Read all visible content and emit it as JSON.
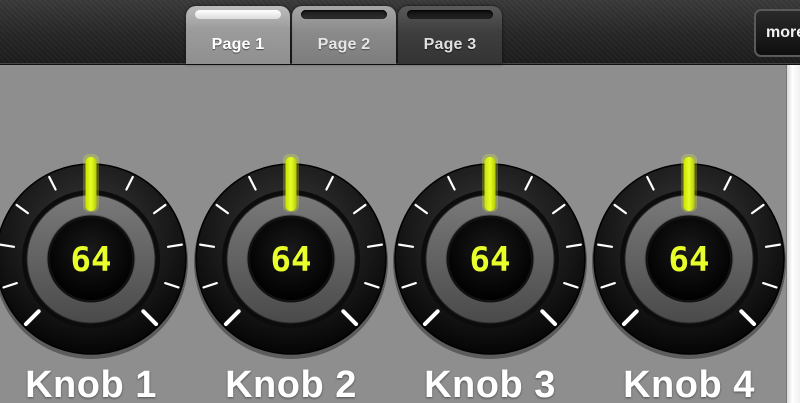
{
  "tabs": [
    {
      "label": "Page 1",
      "active": true
    },
    {
      "label": "Page 2",
      "active": false
    },
    {
      "label": "Page 3",
      "active": false
    }
  ],
  "more_button": {
    "label": "more"
  },
  "knobs": [
    {
      "label": "Knob 1",
      "value": "64"
    },
    {
      "label": "Knob 2",
      "value": "64"
    },
    {
      "label": "Knob 3",
      "value": "64"
    },
    {
      "label": "Knob 4",
      "value": "64"
    }
  ],
  "colors": {
    "indicator": "#e6ff2a",
    "value_text": "#e8ff2a",
    "background": "#8e8e8e"
  }
}
